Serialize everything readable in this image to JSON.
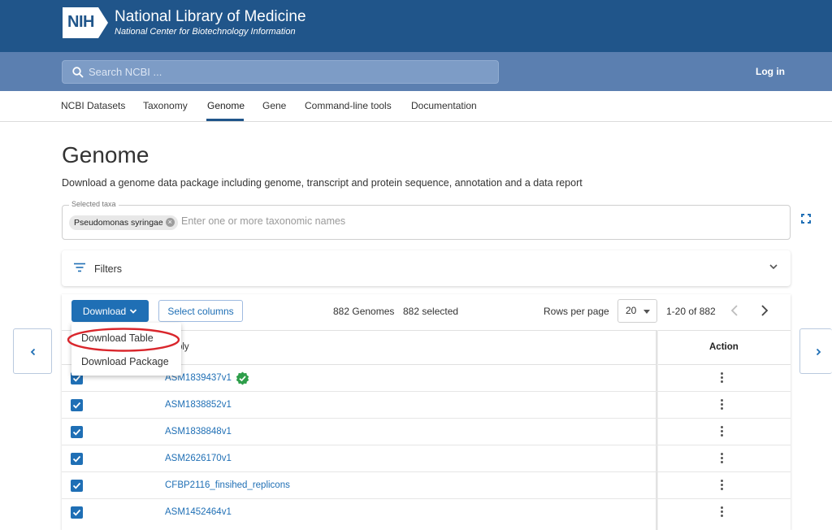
{
  "header": {
    "logo_text": "NIH",
    "title": "National Library of Medicine",
    "subtitle": "National Center for Biotechnology Information"
  },
  "search": {
    "placeholder": "Search NCBI ...",
    "login_label": "Log in"
  },
  "nav": {
    "items": [
      "NCBI Datasets",
      "Taxonomy",
      "Genome",
      "Gene",
      "Command-line tools",
      "Documentation"
    ],
    "active": "Genome"
  },
  "page": {
    "title": "Genome",
    "description": "Download a genome data package including genome, transcript and protein sequence, annotation and a data report"
  },
  "taxa": {
    "legend": "Selected taxa",
    "chip": "Pseudomonas syringae",
    "placeholder": "Enter one or more taxonomic names"
  },
  "filters": {
    "label": "Filters"
  },
  "toolbar": {
    "download_label": "Download",
    "select_columns_label": "Select columns",
    "genome_count": "882 Genomes",
    "selected_count": "882 selected",
    "rows_per_page_label": "Rows per page",
    "rows_per_page_value": "20",
    "page_range": "1-20 of 882"
  },
  "table": {
    "header_assembly": "embly",
    "header_action": "Action",
    "rows": [
      {
        "accession": "ASM1839437v1",
        "checked": true,
        "verified": true
      },
      {
        "accession": "ASM1838852v1",
        "checked": true,
        "verified": false
      },
      {
        "accession": "ASM1838848v1",
        "checked": true,
        "verified": false
      },
      {
        "accession": "ASM2626170v1",
        "checked": true,
        "verified": false
      },
      {
        "accession": "CFBP2116_finsihed_replicons",
        "checked": true,
        "verified": false
      },
      {
        "accession": "ASM1452464v1",
        "checked": true,
        "verified": false
      }
    ]
  },
  "dropdown": {
    "items": [
      "Download Table",
      "Download Package"
    ],
    "highlighted": "Download Table"
  },
  "colors": {
    "banner": "#20558a",
    "search_band": "#5b7fb0",
    "accent": "#1f6fb5",
    "highlight_ring": "#d9262c",
    "verified_badge": "#2e9e4a"
  }
}
